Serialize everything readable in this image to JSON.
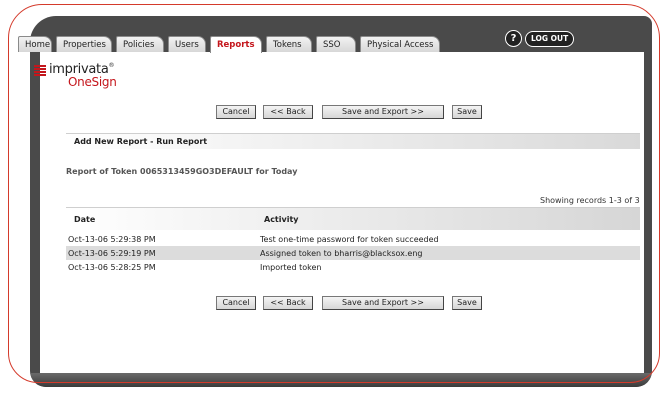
{
  "tabs": [
    {
      "label": "Home",
      "active": false
    },
    {
      "label": "Properties",
      "active": false
    },
    {
      "label": "Policies",
      "active": false
    },
    {
      "label": "Users",
      "active": false
    },
    {
      "label": "Reports",
      "active": true
    },
    {
      "label": "Tokens",
      "active": false
    },
    {
      "label": "SSO",
      "active": false
    },
    {
      "label": "Physical Access",
      "active": false
    }
  ],
  "header": {
    "help_label": "?",
    "logout_label": "LOG OUT"
  },
  "logo": {
    "brand": "imprivata",
    "trademark": "®",
    "product": "OneSign"
  },
  "toolbar": {
    "cancel_label": "Cancel",
    "back_label": "<< Back",
    "save_export_label": "Save and Export >>",
    "save_label": "Save"
  },
  "section": {
    "title": "Add New Report - Run Report"
  },
  "report": {
    "title": "Report of Token 0065313459GO3DEFAULT for Today",
    "records_label": "Showing records 1-3 of 3"
  },
  "table": {
    "columns": [
      "Date",
      "Activity"
    ],
    "rows": [
      {
        "date": "Oct-13-06 5:29:38 PM",
        "activity": "Test one-time password for token succeeded"
      },
      {
        "date": "Oct-13-06 5:29:19 PM",
        "activity": "Assigned token to bharris@blacksox.eng"
      },
      {
        "date": "Oct-13-06 5:28:25 PM",
        "activity": "Imported token"
      }
    ]
  },
  "colors": {
    "accent": "#c4161c",
    "chrome": "#4a4a4a",
    "row_highlight": "#dcdcdc"
  }
}
